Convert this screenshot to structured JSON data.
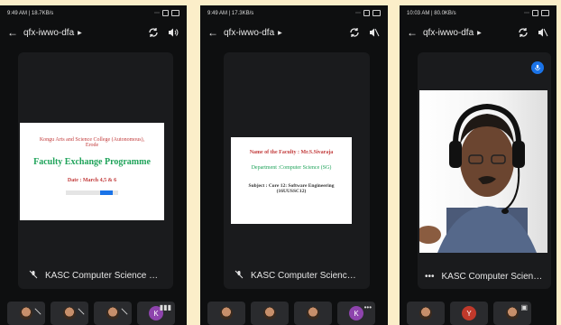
{
  "phones": [
    {
      "status": {
        "time": "9:49 AM | 18.7KB/s",
        "icons": "⋯"
      },
      "meeting_code": "qfx-iwwo-dfa",
      "slide": {
        "college": "Kongu Arts and Science College (Autonomous),",
        "city": "Erode",
        "title": "Faculty Exchange Programme",
        "date": "Date : March 4,5 & 6"
      },
      "footer_label": "KASC Computer Science U...",
      "thumbs": [
        {
          "type": "face"
        },
        {
          "type": "face"
        },
        {
          "type": "face"
        },
        {
          "type": "avatar",
          "initial": "K",
          "color": "#8e44ad"
        }
      ]
    },
    {
      "status": {
        "time": "9:49 AM | 17.3KB/s",
        "icons": "⋯"
      },
      "meeting_code": "qfx-iwwo-dfa",
      "slide": {
        "faculty": "Name of the Faculty : Mr.S.Sivaraja",
        "department": "Department :Computer Science (SG)",
        "subject": "Subject : Core 12: Software Engineering",
        "code": "(16UUSSC12)"
      },
      "footer_label": "KASC Computer Science U...",
      "thumbs": [
        {
          "type": "face"
        },
        {
          "type": "face"
        },
        {
          "type": "face"
        },
        {
          "type": "avatar",
          "initial": "K",
          "color": "#8e44ad"
        }
      ]
    },
    {
      "status": {
        "time": "10:03 AM | 80.0KB/s",
        "icons": "⋯"
      },
      "meeting_code": "qfx-iwwo-dfa",
      "footer_label": "KASC Computer Science U...",
      "thumbs": [
        {
          "type": "face"
        },
        {
          "type": "avatar",
          "initial": "Y",
          "color": "#c0392b"
        },
        {
          "type": "face"
        }
      ]
    }
  ],
  "colors": {
    "background": "#fbeec9",
    "slide_title_green": "#1fa35a",
    "slide_red": "#c23b3b",
    "accent_blue": "#1a73e8"
  }
}
